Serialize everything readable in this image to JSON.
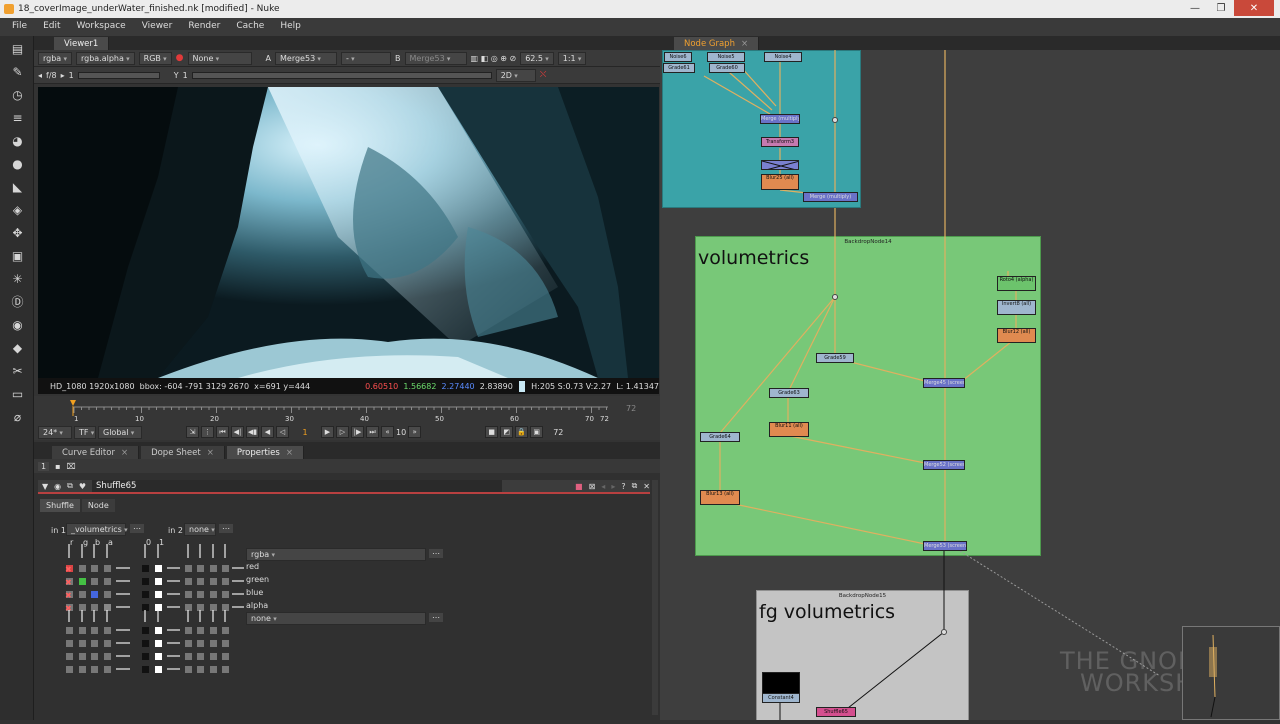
{
  "window": {
    "title": "18_coverImage_underWater_finished.nk [modified] - Nuke",
    "controls": [
      "—",
      "❐",
      "✕"
    ]
  },
  "menu": [
    "File",
    "Edit",
    "Workspace",
    "Viewer",
    "Render",
    "Cache",
    "Help"
  ],
  "viewer": {
    "tab": "Viewer1",
    "channels": "rgba",
    "alpha_channel": "rgba.alpha",
    "colorspace": "RGB",
    "lut": "None",
    "input_a_label": "A",
    "input_a": "Merge53",
    "dash": "-",
    "input_b_label": "B",
    "input_b": "Merge53",
    "zoom": "62.5",
    "ratio": "1:1",
    "fstop": "f/8",
    "gain_val": "1",
    "gamma_label": "Y",
    "gamma_val": "1",
    "mode": "2D",
    "info": {
      "format": "HD_1080 1920x1080",
      "bbox": "bbox: -604 -791 3129 2670",
      "coords": "x=691 y=444",
      "r": "0.60510",
      "g": "1.56682",
      "b": "2.27440",
      "a": "2.83890",
      "hsv": "H:205 S:0.73 V:2.27",
      "lum": "L: 1.41347"
    }
  },
  "timeline": {
    "ticks": [
      "1",
      "10",
      "20",
      "30",
      "40",
      "50",
      "60",
      "70",
      "72"
    ],
    "end": "72",
    "end2": "72",
    "start": "1",
    "fps": "24*",
    "tf": "TF",
    "global": "Global",
    "current_frame": "1",
    "step": "10"
  },
  "bottom_tabs": [
    "Curve Editor",
    "Dope Sheet",
    "Properties"
  ],
  "properties": {
    "count": "1",
    "node_name": "Shuffle65",
    "tabs": [
      "Shuffle",
      "Node"
    ],
    "in1_label": "in 1",
    "in1": "_volumetrics",
    "in2_label": "in 2",
    "in2": "none",
    "cols_left": [
      "r",
      "g",
      "b",
      "a"
    ],
    "cols_mid": [
      "0",
      "1"
    ],
    "out1": "rgba",
    "out2": "none",
    "outputs": [
      "red",
      "green",
      "blue",
      "alpha"
    ]
  },
  "graph": {
    "tab": "Node Graph",
    "backdrop14": {
      "name": "BackdropNode14",
      "title": "volumetrics"
    },
    "backdrop15": {
      "name": "BackdropNode15",
      "title": "fg volumetrics"
    },
    "nodes": {
      "noise6": "Noise6",
      "noise5": "Noise5",
      "noise4": "Noise4",
      "grade61": "Grade61",
      "grade60": "Grade60",
      "merge_top": "Merge (multiply)",
      "transform3": "Transform3",
      "blur25": "Blur25 (all)",
      "merge_mult": "Merge (multiply)",
      "roto4": "Roto4 (alpha)",
      "invert8": "Invert8 (all)",
      "blur12": "Blur12 (all)",
      "grade59": "Grade59",
      "merge_scr1": "Merge45 (screen)",
      "grade63": "Grade63",
      "blur11": "Blur11 (all)",
      "grade64": "Grade64",
      "merge_scr2": "Merge52 (screen)",
      "blur13": "Blur13 (all)",
      "merge_scr3": "Merge53 (screen)",
      "constant4": "Constant4",
      "shuffle65": "Shuffle65"
    }
  },
  "watermark": {
    "line1": "THE GNOMON",
    "line2": "WORKSHOP"
  },
  "colors": {
    "teal_backdrop": "#3aa3a8",
    "green_backdrop": "#78c878",
    "grey_backdrop": "#c4c4c4",
    "pipe": "#e0b060",
    "accent_red": "#b84040"
  }
}
